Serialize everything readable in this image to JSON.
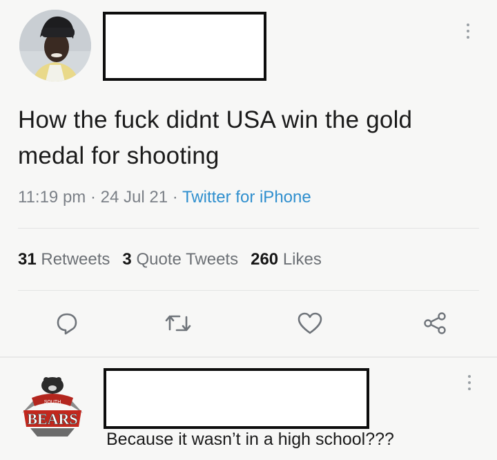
{
  "tweet": {
    "text": "How the fuck didnt USA win the gold medal for shooting",
    "time": "11:19 pm",
    "date": "24 Jul 21",
    "source": "Twitter for iPhone",
    "separator": "·"
  },
  "stats": {
    "retweets_count": "31",
    "retweets_label": "Retweets",
    "quotes_count": "3",
    "quotes_label": "Quote Tweets",
    "likes_count": "260",
    "likes_label": "Likes"
  },
  "actions": [
    {
      "icon": "reply-icon"
    },
    {
      "icon": "retweet-icon"
    },
    {
      "icon": "like-heart-icon"
    },
    {
      "icon": "share-icon"
    }
  ],
  "reply": {
    "text": "Because it wasn’t in a high school???",
    "avatar_banner": "BEARS",
    "avatar_small_text": "SOUTH"
  },
  "colors": {
    "link": "#2f8fce",
    "meta": "#7b8087",
    "icon": "#6f747a",
    "redaction_border": "#0d0d0d"
  }
}
